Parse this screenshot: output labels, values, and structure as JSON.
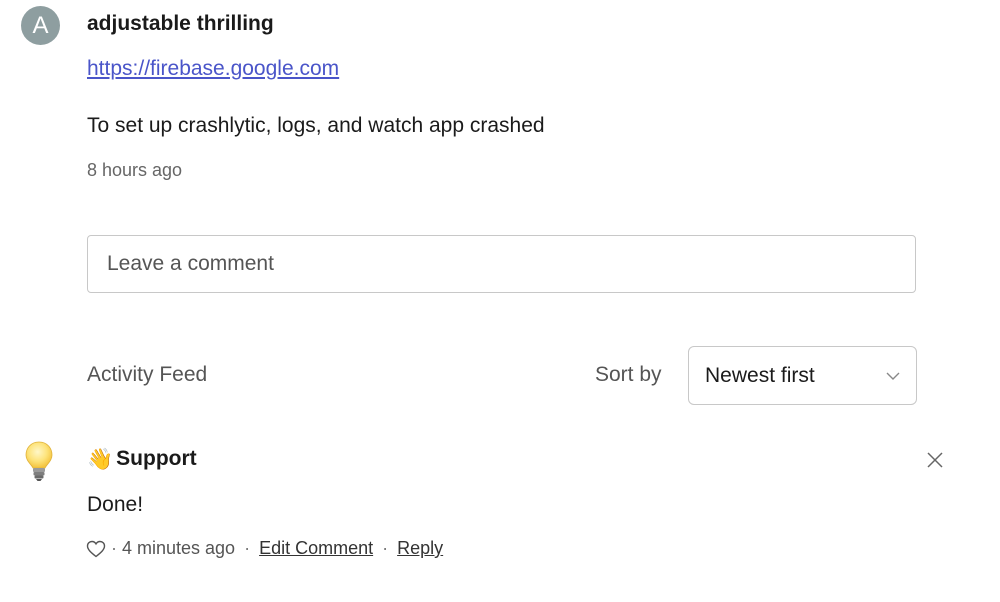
{
  "post": {
    "avatar_initial": "A",
    "author": "adjustable thrilling",
    "link": "https://firebase.google.com",
    "body": "To set up crashlytic, logs, and watch app crashed",
    "time": "8 hours ago"
  },
  "comment": {
    "placeholder": "Leave a comment"
  },
  "feed": {
    "title": "Activity Feed",
    "sort_label": "Sort by",
    "sort_value": "Newest first"
  },
  "reply": {
    "icon": "lightbulb-icon",
    "wave": "👋",
    "author": "Support",
    "body": "Done!",
    "time": "4 minutes ago",
    "edit_label": "Edit Comment",
    "reply_label": "Reply",
    "separator": "·"
  },
  "colors": {
    "avatar": "#8e9ea0",
    "link": "#4a55c9",
    "border": "#c8c8c8",
    "muted": "#666666"
  }
}
